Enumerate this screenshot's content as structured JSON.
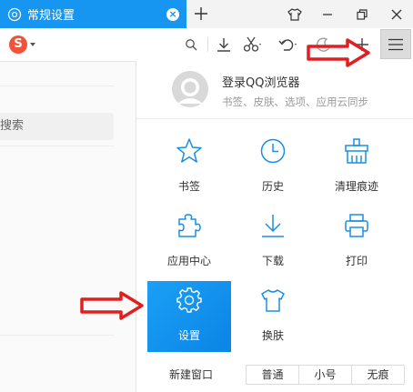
{
  "tab": {
    "title": "常规设置",
    "close": "×"
  },
  "toolbar": {
    "engine_logo": "S"
  },
  "background_page": {
    "search_text": "搜索"
  },
  "menu": {
    "login": {
      "title": "登录QQ浏览器",
      "subtitle": "书签、皮肤、选项、应用云同步"
    },
    "items": [
      {
        "label": "书签",
        "icon": "star-icon"
      },
      {
        "label": "历史",
        "icon": "clock-icon"
      },
      {
        "label": "清理痕迹",
        "icon": "broom-icon"
      },
      {
        "label": "应用中心",
        "icon": "puzzle-icon"
      },
      {
        "label": "下载",
        "icon": "download-icon"
      },
      {
        "label": "打印",
        "icon": "printer-icon"
      },
      {
        "label": "设置",
        "icon": "gear-icon",
        "active": true
      },
      {
        "label": "换肤",
        "icon": "shirt-icon"
      }
    ],
    "footer": {
      "new_window": "新建窗口",
      "zoom": [
        "普通",
        "小号",
        "无痕"
      ]
    }
  },
  "colors": {
    "accent": "#1696f1",
    "annotation": "#e02020"
  }
}
